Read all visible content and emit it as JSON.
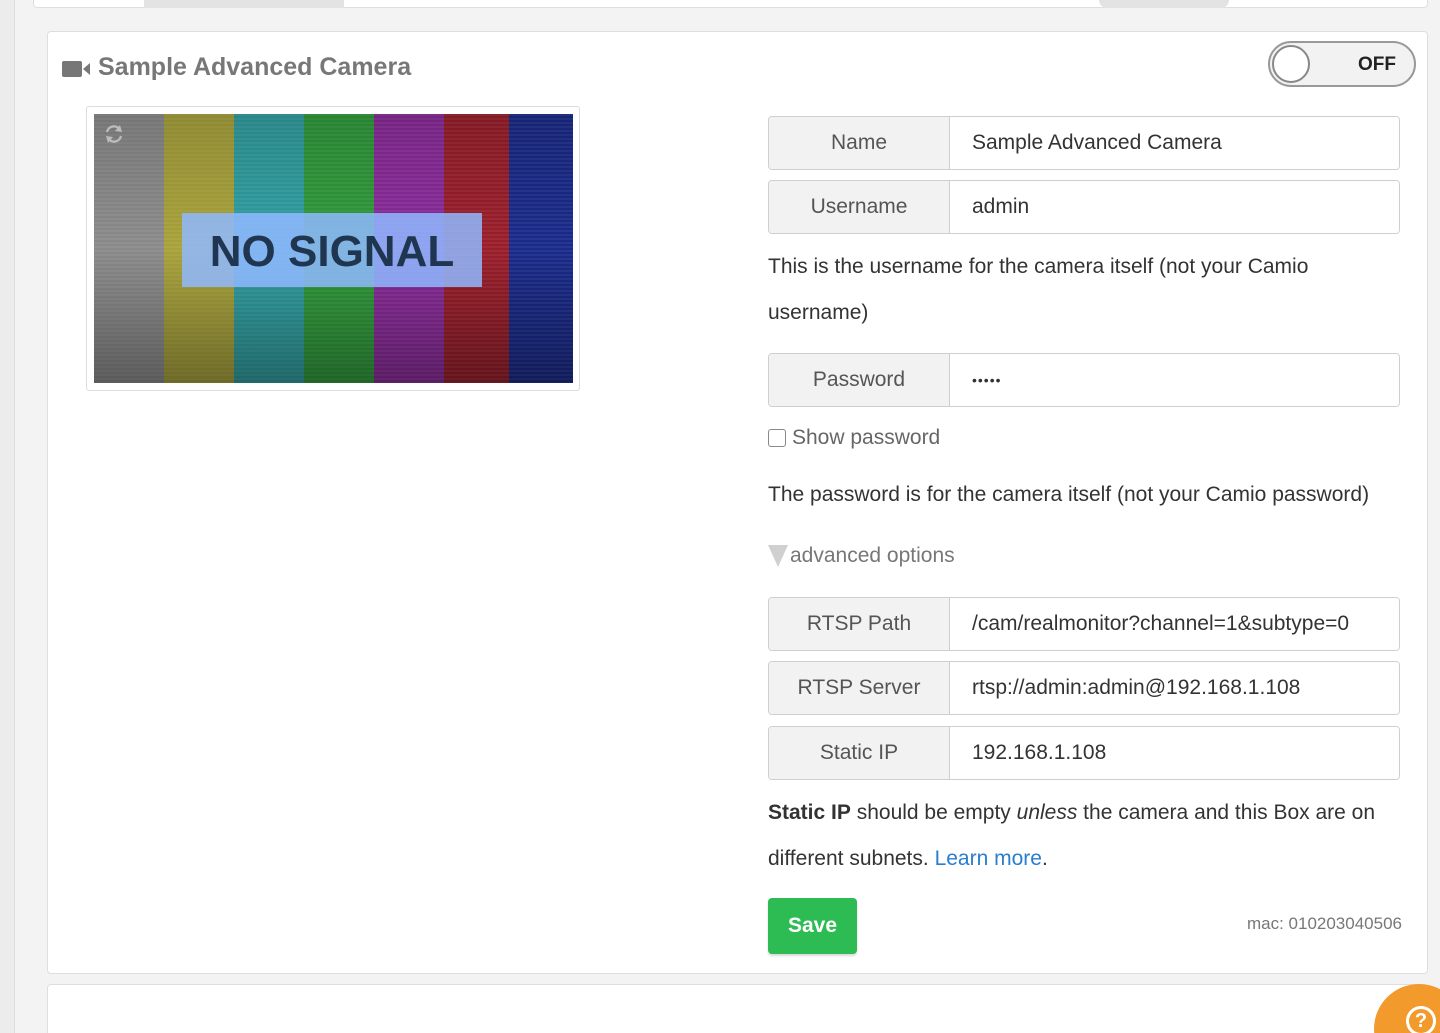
{
  "camera": {
    "title": "Sample Advanced Camera",
    "toggle_label": "OFF",
    "preview_text": "NO SIGNAL"
  },
  "form": {
    "name_label": "Name",
    "name_value": "Sample Advanced Camera",
    "username_label": "Username",
    "username_value": "admin",
    "username_help": "This is the username for the camera itself (not your Camio username)",
    "password_label": "Password",
    "password_value": "•••••",
    "show_password_label": "Show password",
    "password_help": "The password is for the camera itself (not your Camio password)",
    "advanced_label": "advanced options",
    "rtsp_path_label": "RTSP Path",
    "rtsp_path_value": "/cam/realmonitor?channel=1&subtype=0",
    "rtsp_server_label": "RTSP Server",
    "rtsp_server_value": "rtsp://admin:admin@192.168.1.108",
    "static_ip_label": "Static IP",
    "static_ip_value": "192.168.1.108",
    "static_ip_note_bold": "Static IP",
    "static_ip_note_1": " should be empty ",
    "static_ip_note_em": "unless",
    "static_ip_note_2": " the camera and this Box are on different subnets. ",
    "learn_more": "Learn more",
    "period": ".",
    "save_label": "Save",
    "mac": "mac: 010203040506"
  },
  "help_button_label": "?",
  "colors": {
    "save": "#2dbb54",
    "link": "#2a7dd1",
    "help": "#f39a2c"
  }
}
